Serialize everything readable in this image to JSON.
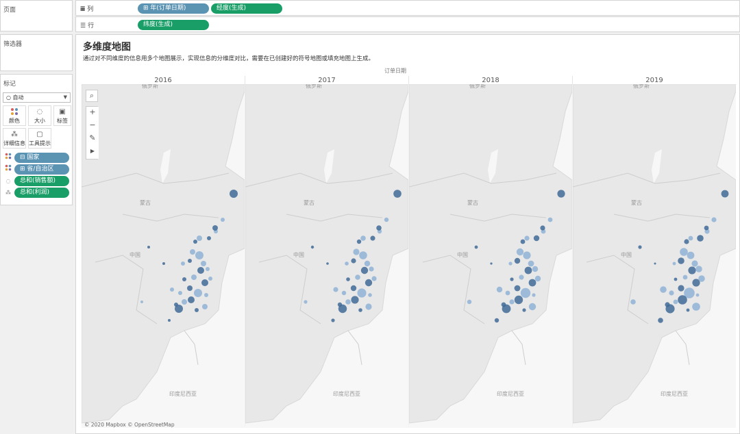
{
  "sidebar": {
    "pages_title": "页面",
    "filters_title": "筛选器",
    "marks_title": "标记",
    "mark_type": "自动",
    "mark_buttons": [
      {
        "label": "颜色",
        "icon": "color-dots-icon"
      },
      {
        "label": "大小",
        "icon": "size-icon"
      },
      {
        "label": "标签",
        "icon": "label-icon"
      },
      {
        "label": "详细信息",
        "icon": "detail-icon"
      },
      {
        "label": "工具提示",
        "icon": "tooltip-icon"
      }
    ],
    "mark_fields": [
      {
        "label": "国家",
        "icon": "color-dots-icon",
        "prefix": "⊟",
        "color": "blue"
      },
      {
        "label": "省/自治区",
        "icon": "color-dots-icon",
        "prefix": "⊞",
        "color": "blue"
      },
      {
        "label": "总和(销售额)",
        "icon": "size-icon",
        "prefix": "",
        "color": "green"
      },
      {
        "label": "总和(利润)",
        "icon": "detail-icon",
        "prefix": "",
        "color": "green"
      }
    ]
  },
  "shelves": {
    "columns_label": "列",
    "rows_label": "行",
    "columns_pills": [
      {
        "label": "⊞ 年(订单日期)",
        "color": "blue"
      },
      {
        "label": "经度(生成)",
        "color": "green"
      }
    ],
    "rows_pills": [
      {
        "label": "纬度(生成)",
        "color": "green"
      }
    ]
  },
  "view": {
    "title": "多维度地图",
    "subtitle": "通过对不同维度的信息用多个地图展示，实现信息的分维度对比，需要在已创建好的符号地图或填充地图上生成。",
    "column_header": "订单日期",
    "years": [
      "2016",
      "2017",
      "2018",
      "2019"
    ],
    "map_labels": {
      "north": "俄罗斯",
      "mongolia": "蒙古",
      "china": "中国",
      "south": "印度尼西亚"
    },
    "attribution": "© 2020 Mapbox © OpenStreetMap"
  },
  "colors": {
    "pill_blue": "#5b93b3",
    "pill_green": "#1a9e68",
    "map_land": "#e8e8e8",
    "map_water": "#f7f7f7",
    "point_dark": "#3f6a96",
    "point_light": "#8fb3d6"
  }
}
